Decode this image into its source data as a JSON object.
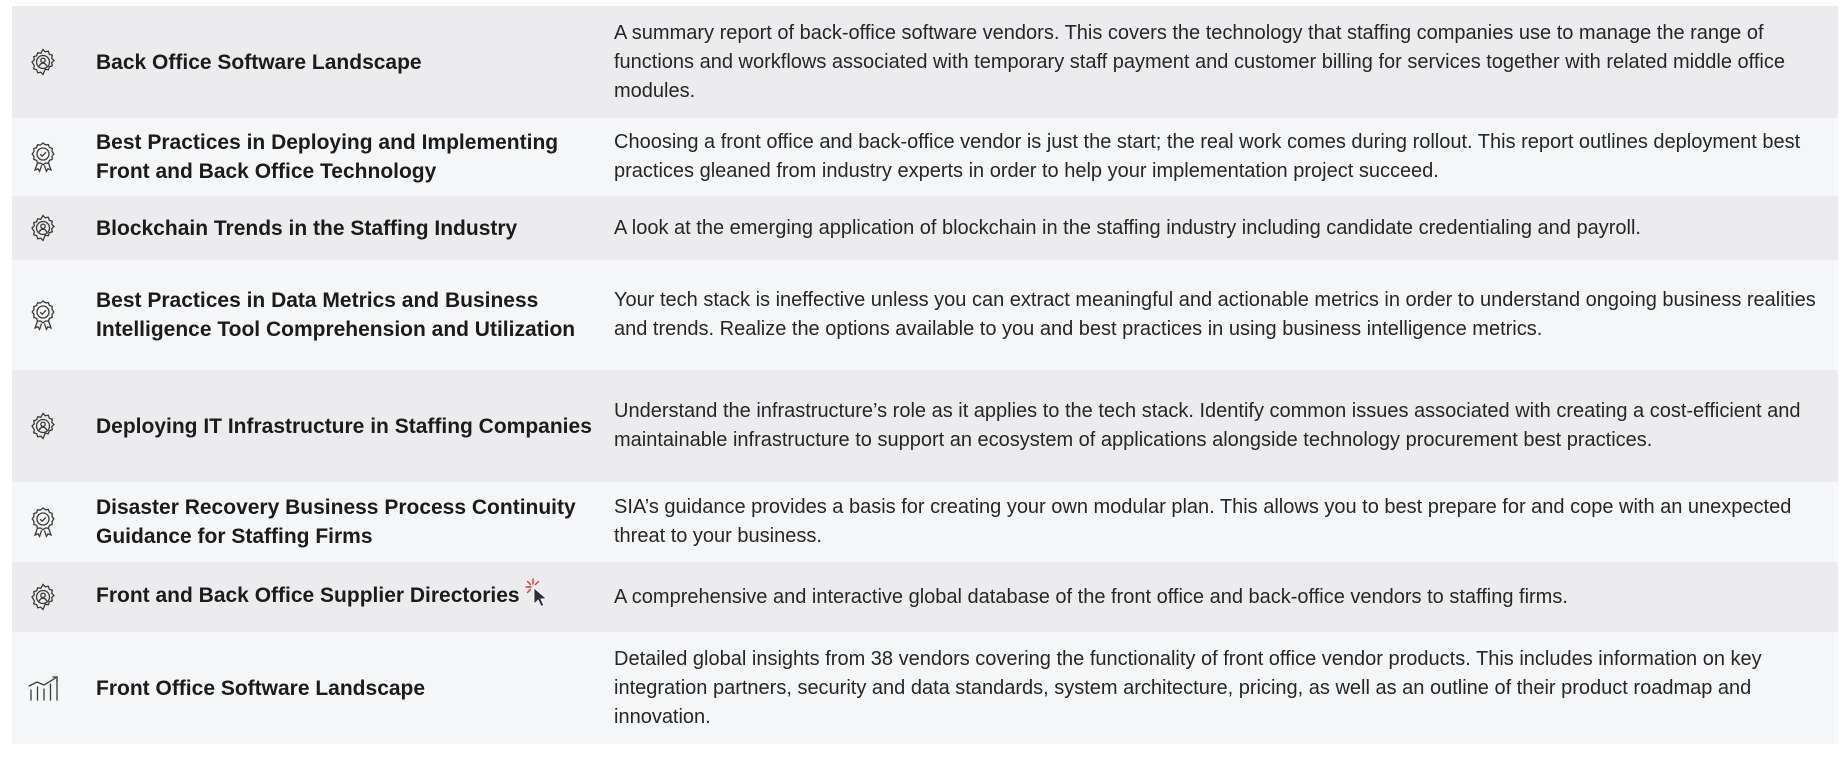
{
  "reports": [
    {
      "icon": "gear-icon",
      "title": "Back Office Software Landscape",
      "description": "A summary report of back-office software vendors. This covers the technology that staffing companies use to manage the range of functions and workflows associated with temporary staff payment and customer billing for services together with related middle office modules."
    },
    {
      "icon": "award-badge-icon",
      "title": "Best Practices in Deploying and Implementing Front and Back Office Technology",
      "description": "Choosing a front office and back-office vendor is just the start; the real work comes during rollout. This report outlines deployment best practices gleaned from industry experts in order to help your implementation project succeed."
    },
    {
      "icon": "gear-icon",
      "title": "Blockchain Trends in the Staffing Industry",
      "description": "A look at the emerging application of blockchain in the staffing industry including candidate credentialing and payroll."
    },
    {
      "icon": "award-badge-icon",
      "title": "Best Practices in Data Metrics and Business Intelligence Tool Comprehension and Utilization",
      "description": "Your tech stack is ineffective unless you can extract meaningful and actionable metrics in order to understand ongoing business realities and trends. Realize the options available to you and best practices in using business intelligence metrics."
    },
    {
      "icon": "gear-icon",
      "title": "Deploying IT Infrastructure in Staffing Companies",
      "description": "Understand the infrastructure’s role as it applies to the tech stack. Identify common issues associated with creating a cost-efficient and maintainable infrastructure to support an ecosystem of applications alongside technology procurement best practices."
    },
    {
      "icon": "award-badge-icon",
      "title": "Disaster Recovery Business Process Continuity Guidance for Staffing Firms",
      "description": "SIA’s guidance provides a basis for creating your own modular plan. This allows you to best prepare for and cope with an unexpected threat to your business."
    },
    {
      "icon": "gear-icon",
      "title": "Front and Back Office Supplier Directories",
      "description": "A comprehensive and interactive global database of the front office and back-office vendors to staffing firms.",
      "has_click_cursor": true
    },
    {
      "icon": "chart-growth-icon",
      "title": "Front Office Software Landscape",
      "description": "Detailed global insights from 38 vendors covering the functionality of front office vendor products. This includes information on key integration partners, security and data standards, system architecture, pricing, as well as an outline of their product roadmap and innovation."
    }
  ],
  "colors": {
    "row_shade_a": "#ececee",
    "row_shade_b": "#f5f6f7",
    "icon_stroke": "#3a3a3a",
    "cursor_accent": "#e0353a"
  }
}
